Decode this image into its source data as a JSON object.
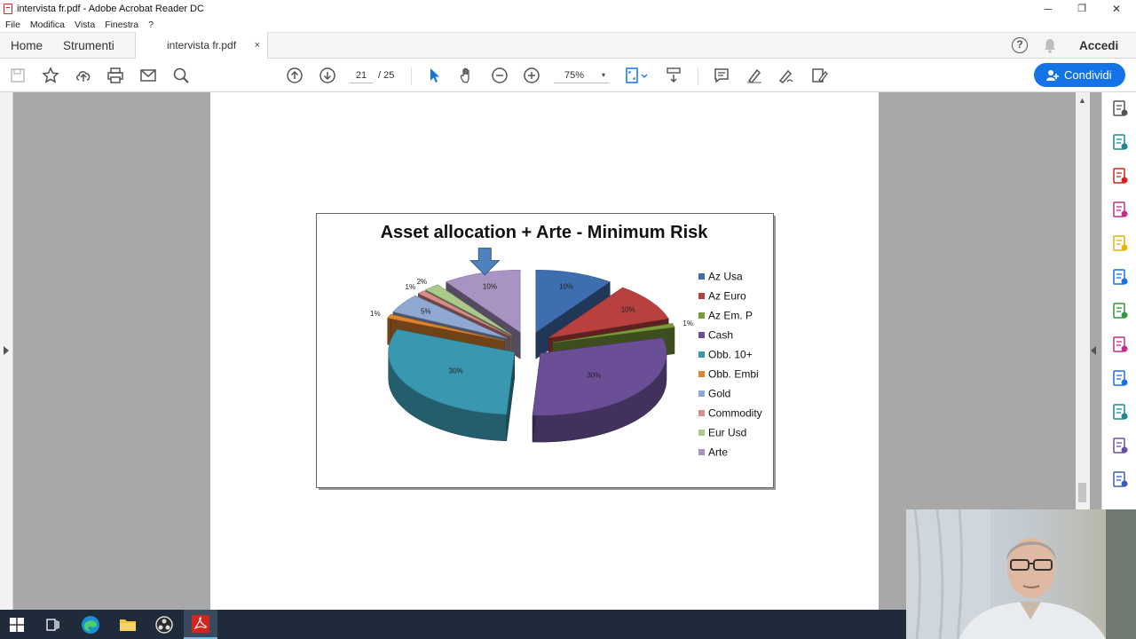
{
  "window": {
    "title": "intervista fr.pdf - Adobe Acrobat Reader DC",
    "minimize": "─",
    "restore": "❐",
    "close": "✕"
  },
  "menu": [
    "File",
    "Modifica",
    "Vista",
    "Finestra",
    "?"
  ],
  "tabs": {
    "home": "Home",
    "tools": "Strumenti",
    "document": "intervista fr.pdf",
    "close": "×",
    "help": "?",
    "sign_in": "Accedi"
  },
  "toolbar": {
    "page_current": "21",
    "page_total": "/  25",
    "zoom": "75%",
    "zoom_caret": "▾",
    "share_label": "Condividi"
  },
  "colors": {
    "accent": "#1473e6",
    "toolbar_icon": "#555555",
    "page_bg": "#a8a8a8"
  },
  "chart_data": {
    "type": "pie",
    "title": "Asset allocation + Arte - Minimum Risk",
    "legend_position": "right",
    "categories": [
      "Az Usa",
      "Az Euro",
      "Az Em. P",
      "Cash",
      "Obb. 10+",
      "Obb. Embi",
      "Gold",
      "Commodity",
      "Eur Usd",
      "Arte"
    ],
    "values": [
      10,
      10,
      1,
      30,
      30,
      1,
      5,
      1,
      2,
      10
    ],
    "labels": [
      "10%",
      "10%",
      "1%",
      "30%",
      "30%",
      "1%",
      "5%",
      "1%",
      "2%",
      "10%"
    ],
    "colors": [
      "#3f6eb0",
      "#b84140",
      "#7a9b3b",
      "#6a4f96",
      "#3a97b0",
      "#e0832d",
      "#8fa9d3",
      "#d98c8a",
      "#aac98a",
      "#a893c2"
    ],
    "exploded": true,
    "highlighted": "Arte"
  },
  "right_rail": [
    "zoom-tool-icon",
    "export-pdf-icon",
    "create-pdf-icon",
    "organize-pages-icon",
    "comment-icon",
    "combine-files-icon",
    "compress-icon",
    "fill-sign-icon",
    "protect-icon",
    "send-for-review-icon",
    "request-signature-icon",
    "redact-icon",
    "more-tools-icon"
  ],
  "taskbar": [
    "windows-start-icon",
    "task-view-icon",
    "edge-browser-icon",
    "file-explorer-icon",
    "obs-studio-icon",
    "acrobat-reader-icon"
  ]
}
